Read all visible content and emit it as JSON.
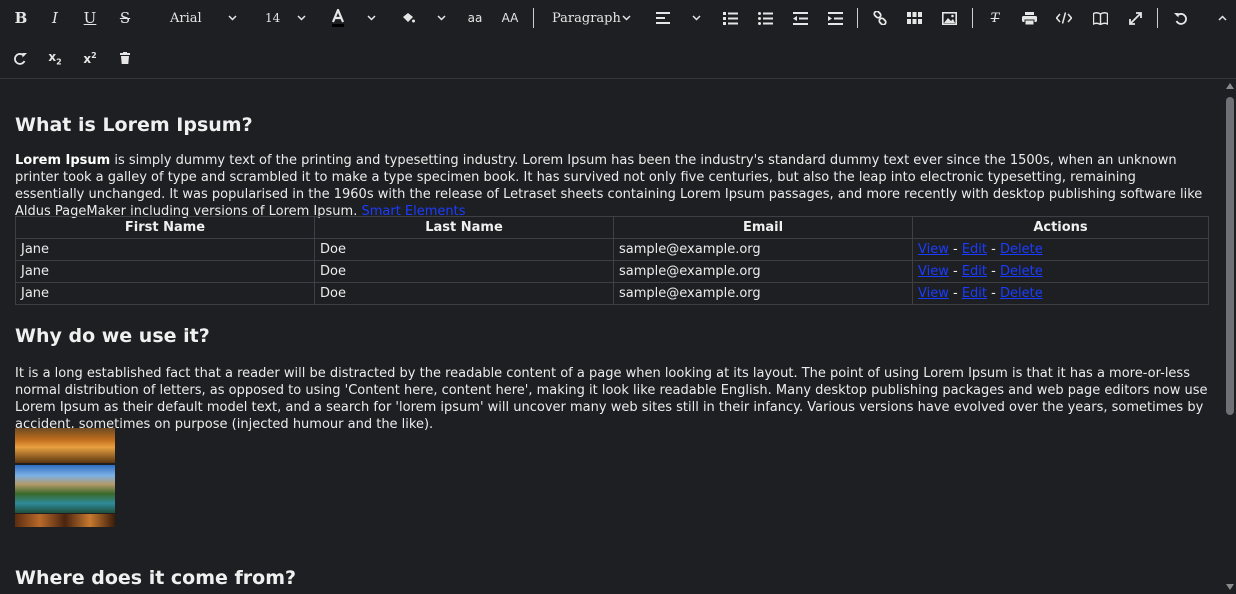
{
  "toolbar": {
    "font_family": "Arial",
    "font_size": "14",
    "lowercase_label": "aa",
    "uppercase_label": "AA",
    "block_format": "Paragraph"
  },
  "doc": {
    "heading1": "What is Lorem Ipsum?",
    "p1_bold": "Lorem Ipsum",
    "p1_text": " is simply dummy text of the printing and typesetting industry. Lorem Ipsum has been the industry's standard dummy text ever since the 1500s, when an unknown printer took a galley of type and scrambled it to make a type specimen book. It has survived not only five centuries, but also the leap into electronic typesetting, remaining essentially unchanged. It was popularised in the 1960s with the release of Letraset sheets containing Lorem Ipsum passages, and more recently with desktop publishing software like Aldus PageMaker including versions of Lorem Ipsum. ",
    "p1_link": "Smart Elements",
    "table": {
      "headers": [
        "First Name",
        "Last Name",
        "Email",
        "Actions"
      ],
      "rows": [
        {
          "first": "Jane",
          "last": "Doe",
          "email": "sample@example.org"
        },
        {
          "first": "Jane",
          "last": "Doe",
          "email": "sample@example.org"
        },
        {
          "first": "Jane",
          "last": "Doe",
          "email": "sample@example.org"
        }
      ],
      "action_view": "View",
      "action_edit": "Edit",
      "action_delete": "Delete",
      "action_sep": " - "
    },
    "heading2": "Why do we use it?",
    "p2": "It is a long established fact that a reader will be distracted by the readable content of a page when looking at its layout. The point of using Lorem Ipsum is that it has a more-or-less normal distribution of letters, as opposed to using 'Content here, content here', making it look like readable English. Many desktop publishing packages and web page editors now use Lorem Ipsum as their default model text, and a search for 'lorem ipsum' will uncover many web sites still in their infancy. Various versions have evolved over the years, sometimes by accident, sometimes on purpose (injected humour and the like).",
    "heading3": "Where does it come from?"
  },
  "colors": {
    "background": "#1e1f22",
    "text": "#ececec",
    "link": "#1a3cff",
    "border": "#3d3f44"
  }
}
